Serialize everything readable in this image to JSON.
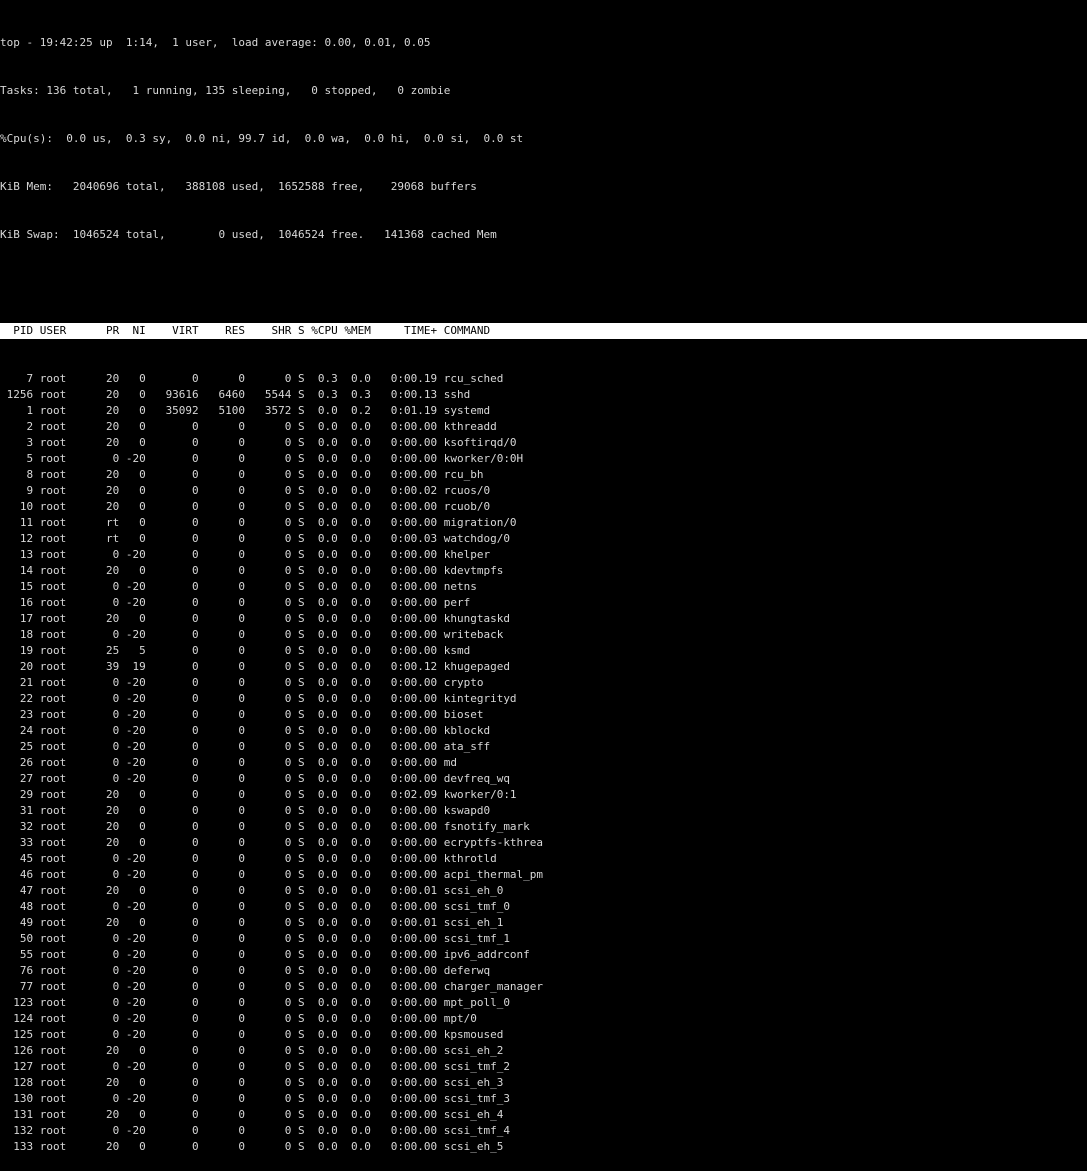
{
  "summary": {
    "top_line": "top - 19:42:25 up  1:14,  1 user,  load average: 0.00, 0.01, 0.05",
    "tasks_line": "Tasks: 136 total,   1 running, 135 sleeping,   0 stopped,   0 zombie",
    "cpu_line": "%Cpu(s):  0.0 us,  0.3 sy,  0.0 ni, 99.7 id,  0.0 wa,  0.0 hi,  0.0 si,  0.0 st",
    "mem_line": "KiB Mem:   2040696 total,   388108 used,  1652588 free,    29068 buffers",
    "swap_line": "KiB Swap:  1046524 total,        0 used,  1046524 free.   141368 cached Mem"
  },
  "table": {
    "header_line": "  PID USER      PR  NI    VIRT    RES    SHR S %CPU %MEM     TIME+ COMMAND",
    "columns": [
      "PID",
      "USER",
      "PR",
      "NI",
      "VIRT",
      "RES",
      "SHR",
      "S",
      "%CPU",
      "%MEM",
      "TIME+",
      "COMMAND"
    ],
    "rows": [
      [
        "7",
        "root",
        "20",
        "0",
        "0",
        "0",
        "0",
        "S",
        "0.3",
        "0.0",
        "0:00.19",
        "rcu_sched"
      ],
      [
        "1256",
        "root",
        "20",
        "0",
        "93616",
        "6460",
        "5544",
        "S",
        "0.3",
        "0.3",
        "0:00.13",
        "sshd"
      ],
      [
        "1",
        "root",
        "20",
        "0",
        "35092",
        "5100",
        "3572",
        "S",
        "0.0",
        "0.2",
        "0:01.19",
        "systemd"
      ],
      [
        "2",
        "root",
        "20",
        "0",
        "0",
        "0",
        "0",
        "S",
        "0.0",
        "0.0",
        "0:00.00",
        "kthreadd"
      ],
      [
        "3",
        "root",
        "20",
        "0",
        "0",
        "0",
        "0",
        "S",
        "0.0",
        "0.0",
        "0:00.00",
        "ksoftirqd/0"
      ],
      [
        "5",
        "root",
        "0",
        "-20",
        "0",
        "0",
        "0",
        "S",
        "0.0",
        "0.0",
        "0:00.00",
        "kworker/0:0H"
      ],
      [
        "8",
        "root",
        "20",
        "0",
        "0",
        "0",
        "0",
        "S",
        "0.0",
        "0.0",
        "0:00.00",
        "rcu_bh"
      ],
      [
        "9",
        "root",
        "20",
        "0",
        "0",
        "0",
        "0",
        "S",
        "0.0",
        "0.0",
        "0:00.02",
        "rcuos/0"
      ],
      [
        "10",
        "root",
        "20",
        "0",
        "0",
        "0",
        "0",
        "S",
        "0.0",
        "0.0",
        "0:00.00",
        "rcuob/0"
      ],
      [
        "11",
        "root",
        "rt",
        "0",
        "0",
        "0",
        "0",
        "S",
        "0.0",
        "0.0",
        "0:00.00",
        "migration/0"
      ],
      [
        "12",
        "root",
        "rt",
        "0",
        "0",
        "0",
        "0",
        "S",
        "0.0",
        "0.0",
        "0:00.03",
        "watchdog/0"
      ],
      [
        "13",
        "root",
        "0",
        "-20",
        "0",
        "0",
        "0",
        "S",
        "0.0",
        "0.0",
        "0:00.00",
        "khelper"
      ],
      [
        "14",
        "root",
        "20",
        "0",
        "0",
        "0",
        "0",
        "S",
        "0.0",
        "0.0",
        "0:00.00",
        "kdevtmpfs"
      ],
      [
        "15",
        "root",
        "0",
        "-20",
        "0",
        "0",
        "0",
        "S",
        "0.0",
        "0.0",
        "0:00.00",
        "netns"
      ],
      [
        "16",
        "root",
        "0",
        "-20",
        "0",
        "0",
        "0",
        "S",
        "0.0",
        "0.0",
        "0:00.00",
        "perf"
      ],
      [
        "17",
        "root",
        "20",
        "0",
        "0",
        "0",
        "0",
        "S",
        "0.0",
        "0.0",
        "0:00.00",
        "khungtaskd"
      ],
      [
        "18",
        "root",
        "0",
        "-20",
        "0",
        "0",
        "0",
        "S",
        "0.0",
        "0.0",
        "0:00.00",
        "writeback"
      ],
      [
        "19",
        "root",
        "25",
        "5",
        "0",
        "0",
        "0",
        "S",
        "0.0",
        "0.0",
        "0:00.00",
        "ksmd"
      ],
      [
        "20",
        "root",
        "39",
        "19",
        "0",
        "0",
        "0",
        "S",
        "0.0",
        "0.0",
        "0:00.12",
        "khugepaged"
      ],
      [
        "21",
        "root",
        "0",
        "-20",
        "0",
        "0",
        "0",
        "S",
        "0.0",
        "0.0",
        "0:00.00",
        "crypto"
      ],
      [
        "22",
        "root",
        "0",
        "-20",
        "0",
        "0",
        "0",
        "S",
        "0.0",
        "0.0",
        "0:00.00",
        "kintegrityd"
      ],
      [
        "23",
        "root",
        "0",
        "-20",
        "0",
        "0",
        "0",
        "S",
        "0.0",
        "0.0",
        "0:00.00",
        "bioset"
      ],
      [
        "24",
        "root",
        "0",
        "-20",
        "0",
        "0",
        "0",
        "S",
        "0.0",
        "0.0",
        "0:00.00",
        "kblockd"
      ],
      [
        "25",
        "root",
        "0",
        "-20",
        "0",
        "0",
        "0",
        "S",
        "0.0",
        "0.0",
        "0:00.00",
        "ata_sff"
      ],
      [
        "26",
        "root",
        "0",
        "-20",
        "0",
        "0",
        "0",
        "S",
        "0.0",
        "0.0",
        "0:00.00",
        "md"
      ],
      [
        "27",
        "root",
        "0",
        "-20",
        "0",
        "0",
        "0",
        "S",
        "0.0",
        "0.0",
        "0:00.00",
        "devfreq_wq"
      ],
      [
        "29",
        "root",
        "20",
        "0",
        "0",
        "0",
        "0",
        "S",
        "0.0",
        "0.0",
        "0:02.09",
        "kworker/0:1"
      ],
      [
        "31",
        "root",
        "20",
        "0",
        "0",
        "0",
        "0",
        "S",
        "0.0",
        "0.0",
        "0:00.00",
        "kswapd0"
      ],
      [
        "32",
        "root",
        "20",
        "0",
        "0",
        "0",
        "0",
        "S",
        "0.0",
        "0.0",
        "0:00.00",
        "fsnotify_mark"
      ],
      [
        "33",
        "root",
        "20",
        "0",
        "0",
        "0",
        "0",
        "S",
        "0.0",
        "0.0",
        "0:00.00",
        "ecryptfs-kthrea"
      ],
      [
        "45",
        "root",
        "0",
        "-20",
        "0",
        "0",
        "0",
        "S",
        "0.0",
        "0.0",
        "0:00.00",
        "kthrotld"
      ],
      [
        "46",
        "root",
        "0",
        "-20",
        "0",
        "0",
        "0",
        "S",
        "0.0",
        "0.0",
        "0:00.00",
        "acpi_thermal_pm"
      ],
      [
        "47",
        "root",
        "20",
        "0",
        "0",
        "0",
        "0",
        "S",
        "0.0",
        "0.0",
        "0:00.01",
        "scsi_eh_0"
      ],
      [
        "48",
        "root",
        "0",
        "-20",
        "0",
        "0",
        "0",
        "S",
        "0.0",
        "0.0",
        "0:00.00",
        "scsi_tmf_0"
      ],
      [
        "49",
        "root",
        "20",
        "0",
        "0",
        "0",
        "0",
        "S",
        "0.0",
        "0.0",
        "0:00.01",
        "scsi_eh_1"
      ],
      [
        "50",
        "root",
        "0",
        "-20",
        "0",
        "0",
        "0",
        "S",
        "0.0",
        "0.0",
        "0:00.00",
        "scsi_tmf_1"
      ],
      [
        "55",
        "root",
        "0",
        "-20",
        "0",
        "0",
        "0",
        "S",
        "0.0",
        "0.0",
        "0:00.00",
        "ipv6_addrconf"
      ],
      [
        "76",
        "root",
        "0",
        "-20",
        "0",
        "0",
        "0",
        "S",
        "0.0",
        "0.0",
        "0:00.00",
        "deferwq"
      ],
      [
        "77",
        "root",
        "0",
        "-20",
        "0",
        "0",
        "0",
        "S",
        "0.0",
        "0.0",
        "0:00.00",
        "charger_manager"
      ],
      [
        "123",
        "root",
        "0",
        "-20",
        "0",
        "0",
        "0",
        "S",
        "0.0",
        "0.0",
        "0:00.00",
        "mpt_poll_0"
      ],
      [
        "124",
        "root",
        "0",
        "-20",
        "0",
        "0",
        "0",
        "S",
        "0.0",
        "0.0",
        "0:00.00",
        "mpt/0"
      ],
      [
        "125",
        "root",
        "0",
        "-20",
        "0",
        "0",
        "0",
        "S",
        "0.0",
        "0.0",
        "0:00.00",
        "kpsmoused"
      ],
      [
        "126",
        "root",
        "20",
        "0",
        "0",
        "0",
        "0",
        "S",
        "0.0",
        "0.0",
        "0:00.00",
        "scsi_eh_2"
      ],
      [
        "127",
        "root",
        "0",
        "-20",
        "0",
        "0",
        "0",
        "S",
        "0.0",
        "0.0",
        "0:00.00",
        "scsi_tmf_2"
      ],
      [
        "128",
        "root",
        "20",
        "0",
        "0",
        "0",
        "0",
        "S",
        "0.0",
        "0.0",
        "0:00.00",
        "scsi_eh_3"
      ],
      [
        "130",
        "root",
        "0",
        "-20",
        "0",
        "0",
        "0",
        "S",
        "0.0",
        "0.0",
        "0:00.00",
        "scsi_tmf_3"
      ],
      [
        "131",
        "root",
        "20",
        "0",
        "0",
        "0",
        "0",
        "S",
        "0.0",
        "0.0",
        "0:00.00",
        "scsi_eh_4"
      ],
      [
        "132",
        "root",
        "0",
        "-20",
        "0",
        "0",
        "0",
        "S",
        "0.0",
        "0.0",
        "0:00.00",
        "scsi_tmf_4"
      ],
      [
        "133",
        "root",
        "20",
        "0",
        "0",
        "0",
        "0",
        "S",
        "0.0",
        "0.0",
        "0:00.00",
        "scsi_eh_5"
      ]
    ]
  },
  "colors": {
    "background": "#000000",
    "foreground": "#d8d8d8",
    "header_bg": "#ffffff",
    "header_fg": "#000000"
  }
}
